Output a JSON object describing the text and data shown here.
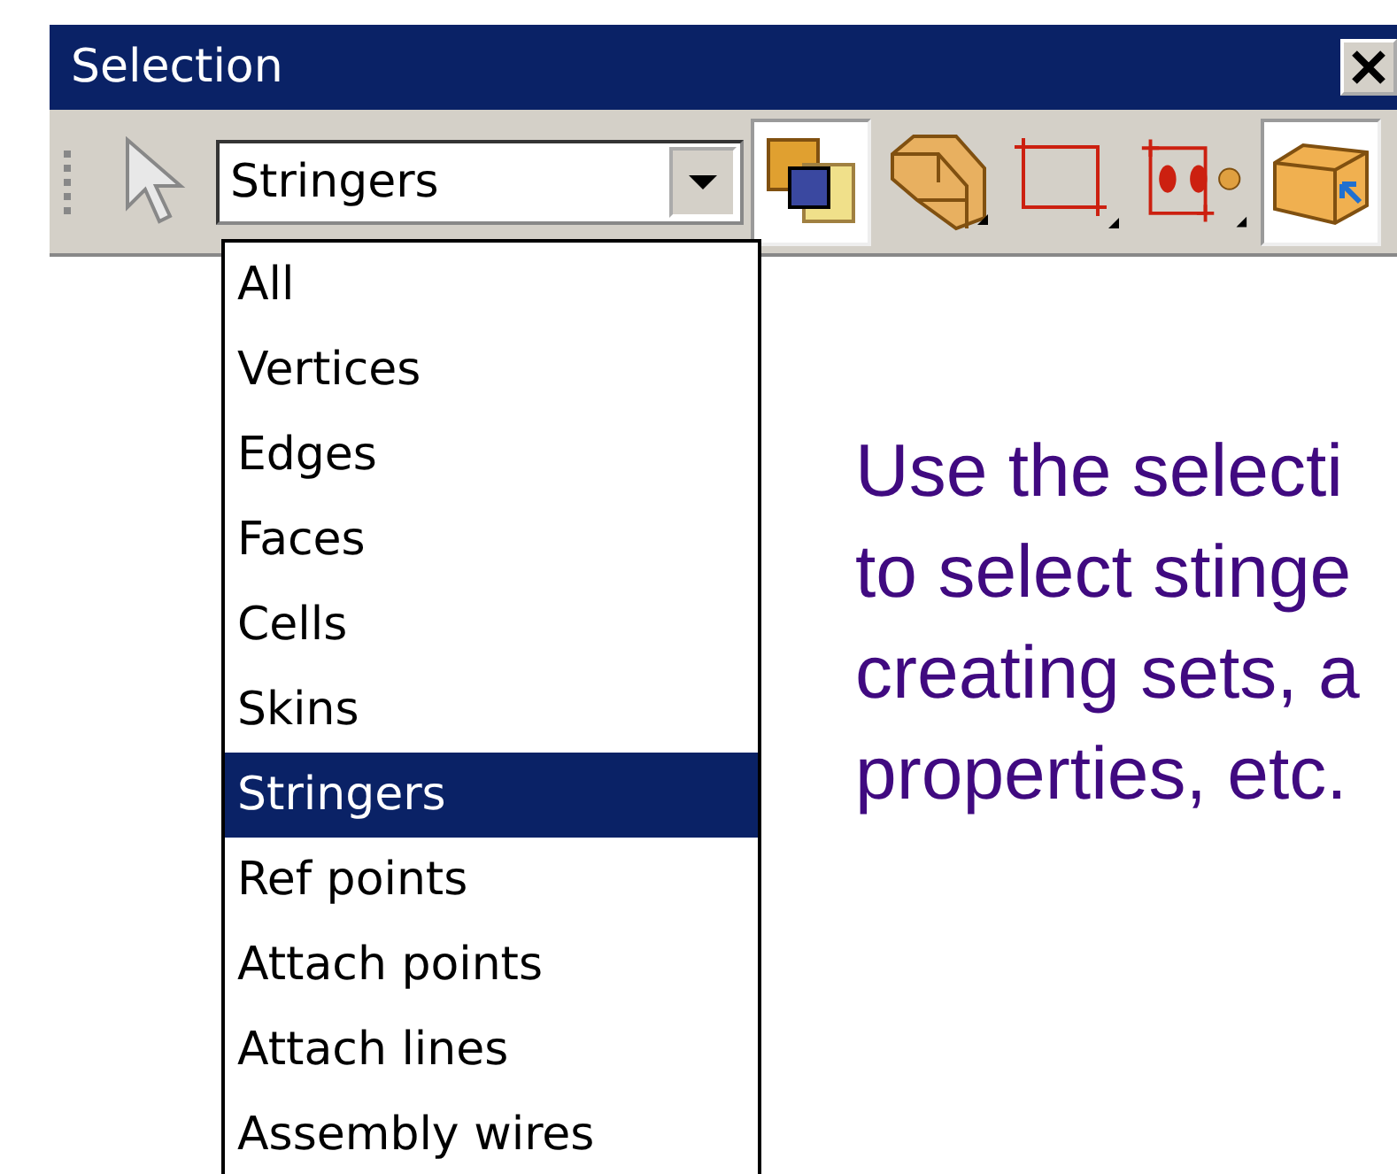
{
  "window": {
    "title": "Selection"
  },
  "toolbar": {
    "combo": {
      "value": "Stringers",
      "expanded": true
    },
    "tools": [
      {
        "kind": "overlap",
        "selected": true
      },
      {
        "kind": "cells",
        "selected": false
      },
      {
        "kind": "frame",
        "selected": false
      },
      {
        "kind": "points",
        "selected": false
      },
      {
        "kind": "box",
        "selected": true
      }
    ]
  },
  "dropdown": {
    "items": [
      {
        "label": "All",
        "selected": false
      },
      {
        "label": "Vertices",
        "selected": false
      },
      {
        "label": "Edges",
        "selected": false
      },
      {
        "label": "Faces",
        "selected": false
      },
      {
        "label": "Cells",
        "selected": false
      },
      {
        "label": "Skins",
        "selected": false
      },
      {
        "label": "Stringers",
        "selected": true
      },
      {
        "label": "Ref points",
        "selected": false
      },
      {
        "label": "Attach points",
        "selected": false
      },
      {
        "label": "Attach lines",
        "selected": false
      },
      {
        "label": "Assembly wires",
        "selected": false
      }
    ]
  },
  "note": {
    "lines": [
      "Use the selecti",
      "to select stinge",
      "creating sets, a",
      "properties, etc."
    ]
  }
}
